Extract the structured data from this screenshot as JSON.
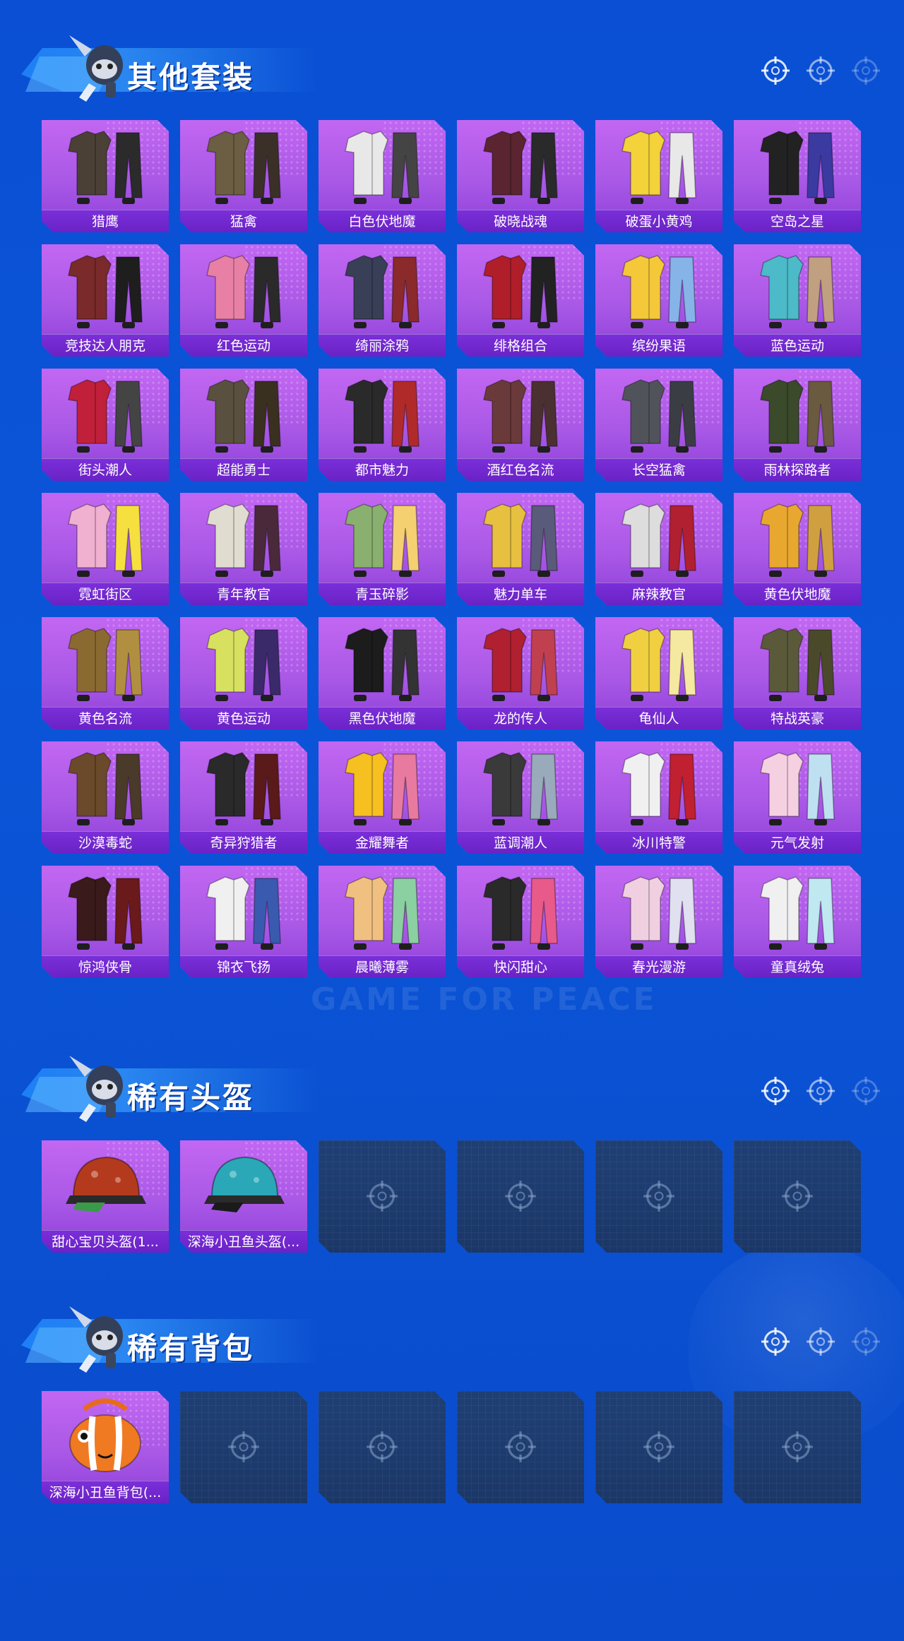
{
  "background": {
    "watermark": "GAME FOR PEACE"
  },
  "colors": {
    "page_bg": "#0a4fd4",
    "card": "#b05ce8",
    "card_label": "#6a22c6",
    "empty_slot": "#1f3f74",
    "banner": "#2a86f0"
  },
  "sections": [
    {
      "title": "其他套装",
      "items": [
        {
          "label": "猎鹰",
          "art": "outfit-icon"
        },
        {
          "label": "猛禽",
          "art": "outfit-icon"
        },
        {
          "label": "白色伏地魔",
          "art": "outfit-icon"
        },
        {
          "label": "破晓战魂",
          "art": "outfit-icon"
        },
        {
          "label": "破蛋小黄鸡",
          "art": "outfit-icon"
        },
        {
          "label": "空岛之星",
          "art": "outfit-icon"
        },
        {
          "label": "竞技达人朋克",
          "art": "outfit-icon"
        },
        {
          "label": "红色运动",
          "art": "outfit-icon"
        },
        {
          "label": "绮丽涂鸦",
          "art": "outfit-icon"
        },
        {
          "label": "绯格组合",
          "art": "outfit-icon"
        },
        {
          "label": "缤纷果语",
          "art": "outfit-icon"
        },
        {
          "label": "蓝色运动",
          "art": "outfit-icon"
        },
        {
          "label": "街头潮人",
          "art": "outfit-icon"
        },
        {
          "label": "超能勇士",
          "art": "outfit-icon"
        },
        {
          "label": "都市魅力",
          "art": "outfit-icon"
        },
        {
          "label": "酒红色名流",
          "art": "outfit-icon"
        },
        {
          "label": "长空猛禽",
          "art": "outfit-icon"
        },
        {
          "label": "雨林探路者",
          "art": "outfit-icon"
        },
        {
          "label": "霓虹街区",
          "art": "outfit-icon"
        },
        {
          "label": "青年教官",
          "art": "outfit-icon"
        },
        {
          "label": "青玉碎影",
          "art": "outfit-icon"
        },
        {
          "label": "魅力单车",
          "art": "outfit-icon"
        },
        {
          "label": "麻辣教官",
          "art": "outfit-icon"
        },
        {
          "label": "黄色伏地魔",
          "art": "outfit-icon"
        },
        {
          "label": "黄色名流",
          "art": "outfit-icon"
        },
        {
          "label": "黄色运动",
          "art": "outfit-icon"
        },
        {
          "label": "黑色伏地魔",
          "art": "outfit-icon"
        },
        {
          "label": "龙的传人",
          "art": "outfit-icon"
        },
        {
          "label": "龟仙人",
          "art": "outfit-icon"
        },
        {
          "label": "特战英豪",
          "art": "outfit-icon"
        },
        {
          "label": "沙漠毒蛇",
          "art": "outfit-icon"
        },
        {
          "label": "奇异狩猎者",
          "art": "outfit-icon"
        },
        {
          "label": "金耀舞者",
          "art": "outfit-icon"
        },
        {
          "label": "蓝调潮人",
          "art": "outfit-icon"
        },
        {
          "label": "冰川特警",
          "art": "outfit-icon"
        },
        {
          "label": "元气发射",
          "art": "outfit-icon"
        },
        {
          "label": "惊鸿侠骨",
          "art": "outfit-icon"
        },
        {
          "label": "锦衣飞扬",
          "art": "outfit-icon"
        },
        {
          "label": "晨曦薄雾",
          "art": "outfit-icon"
        },
        {
          "label": "快闪甜心",
          "art": "outfit-icon"
        },
        {
          "label": "春光漫游",
          "art": "outfit-icon"
        },
        {
          "label": "童真绒兔",
          "art": "outfit-icon"
        }
      ],
      "empty_slots": 0
    },
    {
      "title": "稀有头盔",
      "items": [
        {
          "label": "甜心宝贝头盔(1...",
          "art": "helmet-icon"
        },
        {
          "label": "深海小丑鱼头盔(...",
          "art": "helmet-icon"
        }
      ],
      "empty_slots": 4
    },
    {
      "title": "稀有背包",
      "items": [
        {
          "label": "深海小丑鱼背包(...",
          "art": "backpack-icon"
        }
      ],
      "empty_slots": 5
    }
  ]
}
